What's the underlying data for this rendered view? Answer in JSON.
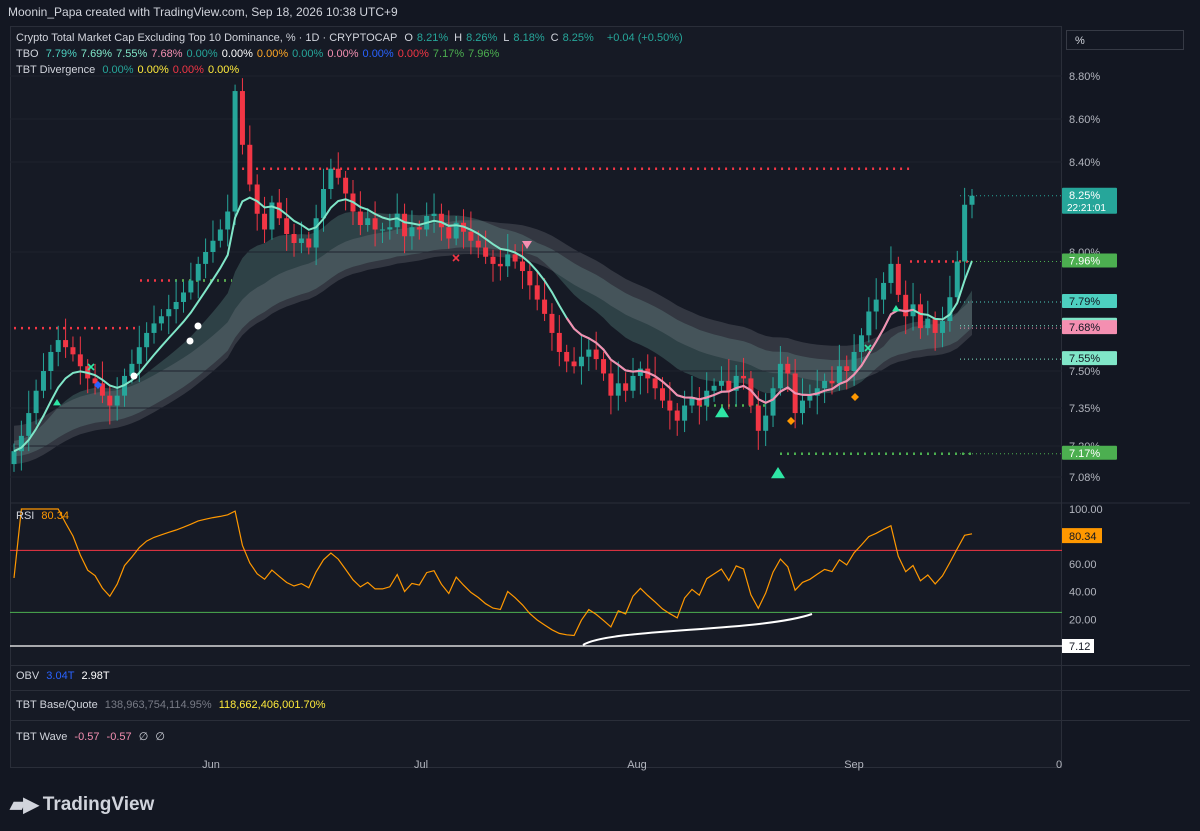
{
  "header": {
    "credit": "Moonin_Papa created with TradingView.com, Sep 18, 2026 10:38 UTC+9"
  },
  "scale_unit": "%",
  "legend": {
    "title": "Crypto Total Market Cap Excluding Top 10 Dominance, % · 1D · CRYPTOCAP",
    "ohlc": [
      {
        "k": "O",
        "v": "8.21%"
      },
      {
        "k": "H",
        "v": "8.26%"
      },
      {
        "k": "L",
        "v": "8.18%"
      },
      {
        "k": "C",
        "v": "8.25%"
      }
    ],
    "change": "+0.04 (+0.50%)",
    "tbo_label": "TBO",
    "tbo_values": [
      {
        "v": "7.79%",
        "c": "#4dd0c0"
      },
      {
        "v": "7.69%",
        "c": "#80e6c8"
      },
      {
        "v": "7.55%",
        "c": "#80e6c8"
      },
      {
        "v": "7.68%",
        "c": "#f48fb1"
      },
      {
        "v": "0.00%",
        "c": "#26a69a"
      },
      {
        "v": "0.00%",
        "c": "#ffffff"
      },
      {
        "v": "0.00%",
        "c": "#ffa726"
      },
      {
        "v": "0.00%",
        "c": "#26a69a"
      },
      {
        "v": "0.00%",
        "c": "#f48fb1"
      },
      {
        "v": "0.00%",
        "c": "#2962ff"
      },
      {
        "v": "0.00%",
        "c": "#f23645"
      },
      {
        "v": "7.17%",
        "c": "#4caf50"
      },
      {
        "v": "7.96%",
        "c": "#4caf50"
      }
    ],
    "div_label": "TBT Divergence",
    "div_values": [
      {
        "v": "0.00%",
        "c": "#26a69a"
      },
      {
        "v": "0.00%",
        "c": "#ffeb3b"
      },
      {
        "v": "0.00%",
        "c": "#f23645"
      },
      {
        "v": "0.00%",
        "c": "#ffeb3b"
      }
    ]
  },
  "rsi": {
    "label": "RSI",
    "value": "80.34",
    "ticks": [
      "100.00",
      "80.00",
      "60.00",
      "40.00",
      "20.00"
    ],
    "marker": "7.12",
    "overbought": 70,
    "oversold": 25
  },
  "obv": {
    "label": "OBV",
    "v1": "3.04T",
    "v2": "2.98T"
  },
  "base_quote": {
    "label": "TBT Base/Quote",
    "v1": "138,963,754,114.95%",
    "v2": "118,662,406,001.70%"
  },
  "wave": {
    "label": "TBT Wave",
    "v1": "-0.57",
    "v2": "-0.57",
    "v3": "∅",
    "v4": "∅"
  },
  "price_axis": {
    "ticks": [
      "8.80%",
      "8.60%",
      "8.40%",
      "8.00%",
      "7.50%",
      "7.35%",
      "7.20%",
      "7.08%"
    ],
    "tags": [
      {
        "text": "8.25%",
        "sub": "22:21:01",
        "bg": "#26a69a",
        "fg": "#ffffff",
        "value": 8.25
      },
      {
        "text": "7.96%",
        "bg": "#4caf50",
        "fg": "#ffffff",
        "value": 7.96
      },
      {
        "text": "7.79%",
        "bg": "#4dd0c0",
        "fg": "#131722",
        "value": 7.79
      },
      {
        "text": "7.69%",
        "bg": "#80e6c8",
        "fg": "#131722",
        "value": 7.69
      },
      {
        "text": "7.68%",
        "bg": "#f48fb1",
        "fg": "#131722",
        "value": 7.68
      },
      {
        "text": "7.55%",
        "bg": "#80e6c8",
        "fg": "#131722",
        "value": 7.55
      },
      {
        "text": "7.17%",
        "bg": "#4caf50",
        "fg": "#ffffff",
        "value": 7.17
      }
    ]
  },
  "time_axis": [
    "Jun",
    "Jul",
    "Aug",
    "Sep",
    "0"
  ],
  "brand": {
    "name": "TradingView"
  },
  "chart_data": {
    "type": "candlestick",
    "title": "Crypto Total Market Cap Excluding Top 10 Dominance, % · 1D · CRYPTOCAP",
    "ylim": [
      7.0,
      8.85
    ],
    "x_labels": [
      "Jun",
      "Jul",
      "Aug",
      "Sep"
    ],
    "closes": [
      7.18,
      7.24,
      7.33,
      7.42,
      7.5,
      7.58,
      7.63,
      7.6,
      7.57,
      7.52,
      7.47,
      7.45,
      7.4,
      7.36,
      7.4,
      7.48,
      7.53,
      7.6,
      7.66,
      7.7,
      7.73,
      7.76,
      7.79,
      7.83,
      7.88,
      7.95,
      8.0,
      8.05,
      8.1,
      8.18,
      8.73,
      8.48,
      8.3,
      8.17,
      8.1,
      8.22,
      8.15,
      8.08,
      8.04,
      8.06,
      8.02,
      8.15,
      8.28,
      8.37,
      8.33,
      8.26,
      8.18,
      8.12,
      8.15,
      8.1,
      8.1,
      8.11,
      8.17,
      8.07,
      8.11,
      8.1,
      8.16,
      8.17,
      8.11,
      8.06,
      8.13,
      8.09,
      8.05,
      8.02,
      7.98,
      7.95,
      7.94,
      7.99,
      7.96,
      7.92,
      7.86,
      7.8,
      7.74,
      7.66,
      7.58,
      7.54,
      7.52,
      7.56,
      7.59,
      7.55,
      7.49,
      7.4,
      7.45,
      7.42,
      7.48,
      7.51,
      7.47,
      7.43,
      7.38,
      7.34,
      7.3,
      7.36,
      7.39,
      7.36,
      7.42,
      7.44,
      7.46,
      7.42,
      7.48,
      7.47,
      7.36,
      7.26,
      7.32,
      7.43,
      7.53,
      7.49,
      7.33,
      7.38,
      7.4,
      7.43,
      7.46,
      7.45,
      7.52,
      7.5,
      7.58,
      7.65,
      7.75,
      7.8,
      7.87,
      7.95,
      7.82,
      7.73,
      7.78,
      7.68,
      7.72,
      7.66,
      7.71,
      7.81,
      7.96,
      8.21,
      8.25
    ],
    "ema_fast": {
      "name": "7.79%",
      "color": "#80e6c8"
    },
    "oversold_line": 25,
    "overbought_line": 70,
    "resistance_level": 8.37,
    "support_levels": [
      7.17,
      7.96
    ]
  }
}
